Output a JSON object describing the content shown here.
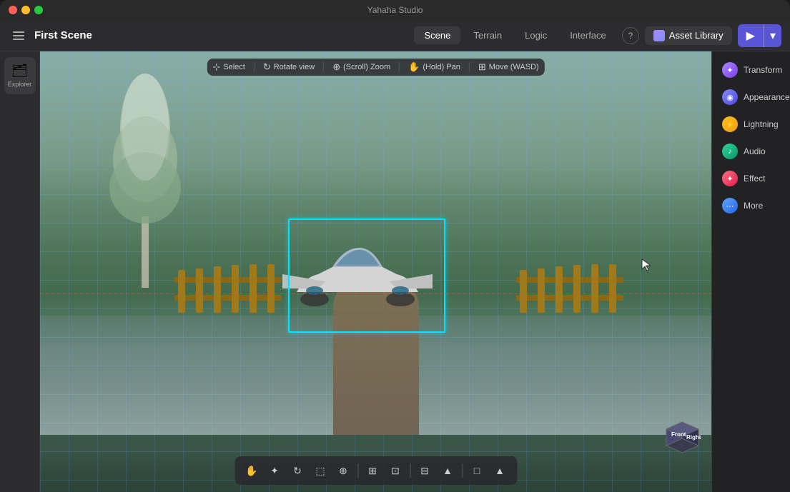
{
  "app": {
    "title": "Yahaha Studio"
  },
  "titleBar": {
    "title": "Yahaha Studio",
    "trafficLights": [
      "close",
      "minimize",
      "maximize"
    ]
  },
  "menuBar": {
    "sceneTitle": "First Scene",
    "tabs": [
      {
        "id": "scene",
        "label": "Scene",
        "active": true
      },
      {
        "id": "terrain",
        "label": "Terrain",
        "active": false
      },
      {
        "id": "logic",
        "label": "Logic",
        "active": false
      },
      {
        "id": "interface",
        "label": "Interface",
        "active": false
      }
    ],
    "helpLabel": "?",
    "assetLibraryLabel": "Asset Library",
    "playLabel": "▶"
  },
  "explorer": {
    "label": "Explorer"
  },
  "viewport": {
    "toolbar": {
      "items": [
        {
          "id": "select",
          "icon": "⊹",
          "label": "Select"
        },
        {
          "id": "rotate",
          "icon": "↻",
          "label": "Rotate view"
        },
        {
          "id": "zoom",
          "icon": "⊕",
          "label": "(Scroll) Zoom"
        },
        {
          "id": "pan",
          "icon": "✋",
          "label": "(Hold) Pan"
        },
        {
          "id": "move",
          "icon": "⊞",
          "label": "Move (WASD)"
        }
      ]
    },
    "bottomToolbar": {
      "buttons": [
        "✋",
        "⊹",
        "↻",
        "⬚",
        "⊕",
        "⊞",
        "⊡",
        "⊟",
        "⊠",
        "⊞",
        "⊟"
      ]
    },
    "compass": {
      "frontLabel": "Front",
      "rightLabel": "Right"
    }
  },
  "rightPanel": {
    "items": [
      {
        "id": "transform",
        "label": "Transform",
        "iconClass": "icon-transform",
        "icon": "✦"
      },
      {
        "id": "appearance",
        "label": "Appearance",
        "iconClass": "icon-appearance",
        "icon": "◉"
      },
      {
        "id": "lightning",
        "label": "Lightning",
        "iconClass": "icon-lightning",
        "icon": "⚡"
      },
      {
        "id": "audio",
        "label": "Audio",
        "iconClass": "icon-audio",
        "icon": "♪"
      },
      {
        "id": "effect",
        "label": "Effect",
        "iconClass": "icon-effect",
        "icon": "✦"
      },
      {
        "id": "more",
        "label": "More",
        "iconClass": "icon-more",
        "icon": "⋯"
      }
    ]
  }
}
